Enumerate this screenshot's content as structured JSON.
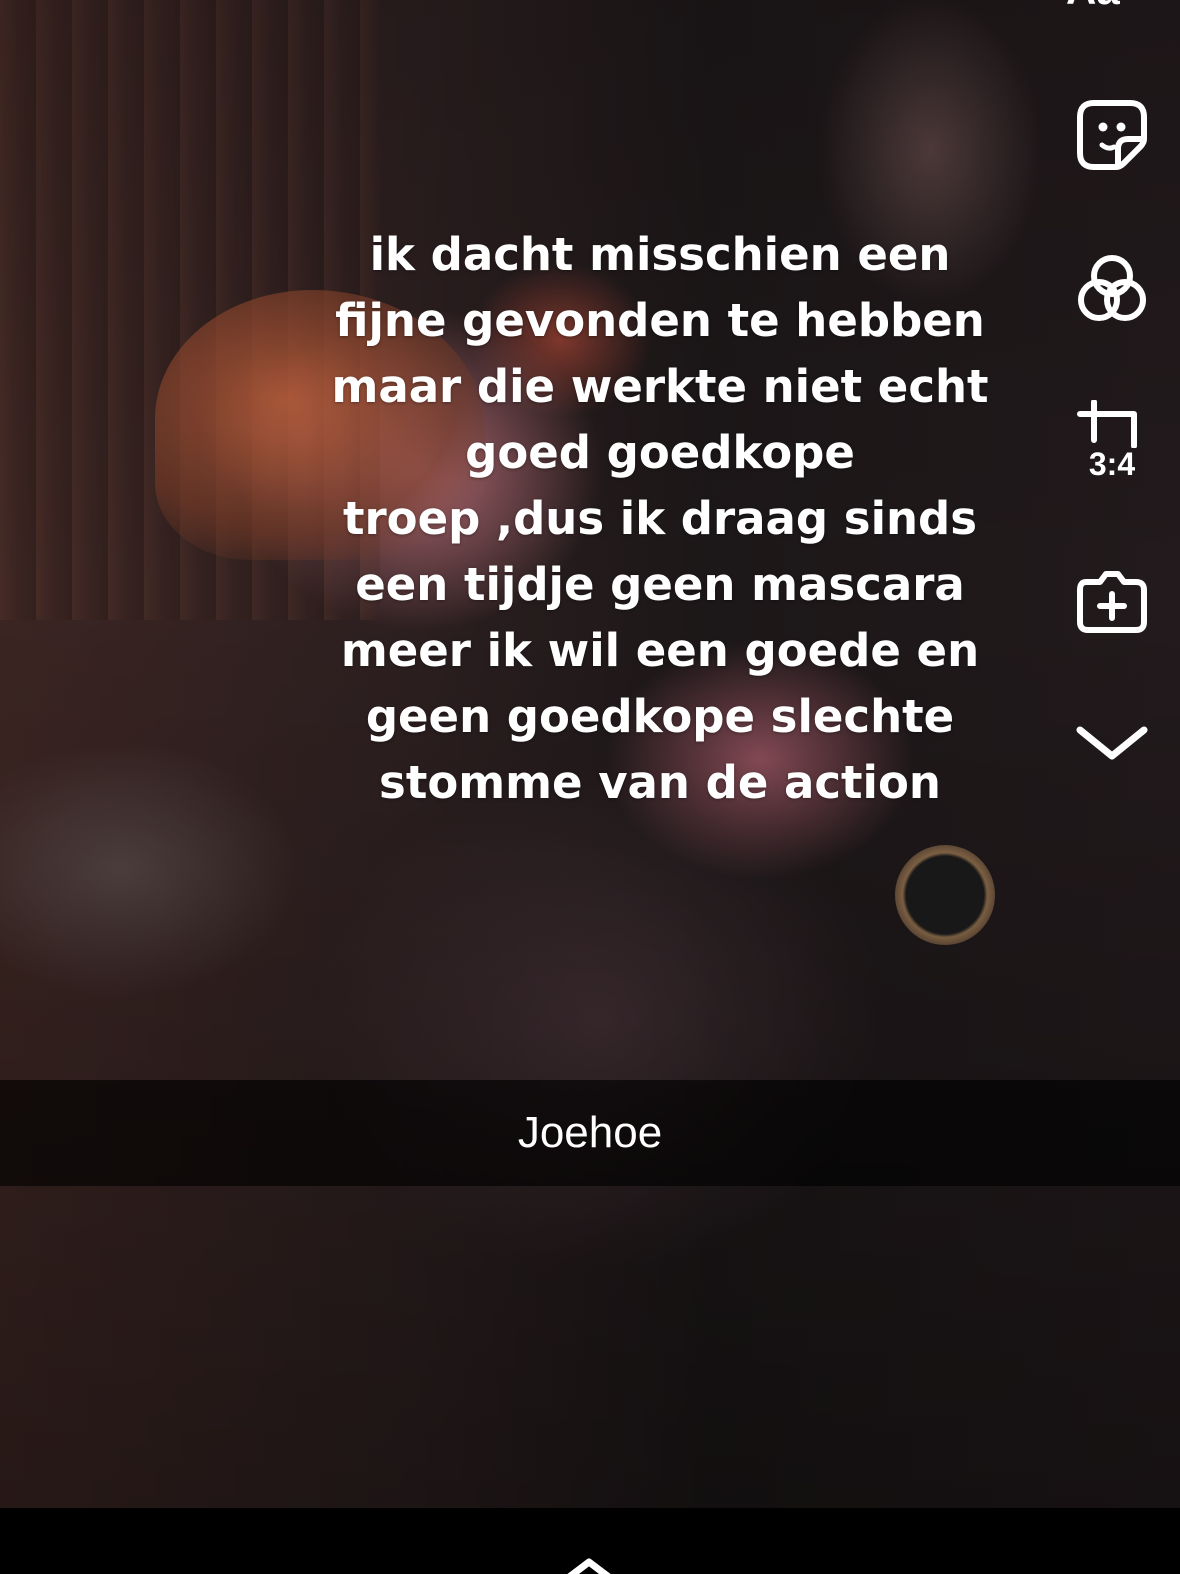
{
  "caption": {
    "lines": [
      "ik dacht misschien een",
      "fijne gevonden te hebben",
      "maar die werkte niet echt",
      "goed goedkope",
      "troep ,dus ik draag sinds",
      "een tijdje geen mascara",
      "meer ik wil een goede en",
      "geen goedkope slechte",
      "stomme van de action"
    ]
  },
  "subtitle": {
    "text": "Joehoe"
  },
  "tools": {
    "text_label": "Aa",
    "crop_ratio": "3:4",
    "items": [
      "sticker-icon",
      "filter-icon",
      "crop-icon",
      "add-clip-icon",
      "chevron-down-icon"
    ]
  },
  "colors": {
    "text": "#ffffff",
    "bar": "#000000"
  }
}
